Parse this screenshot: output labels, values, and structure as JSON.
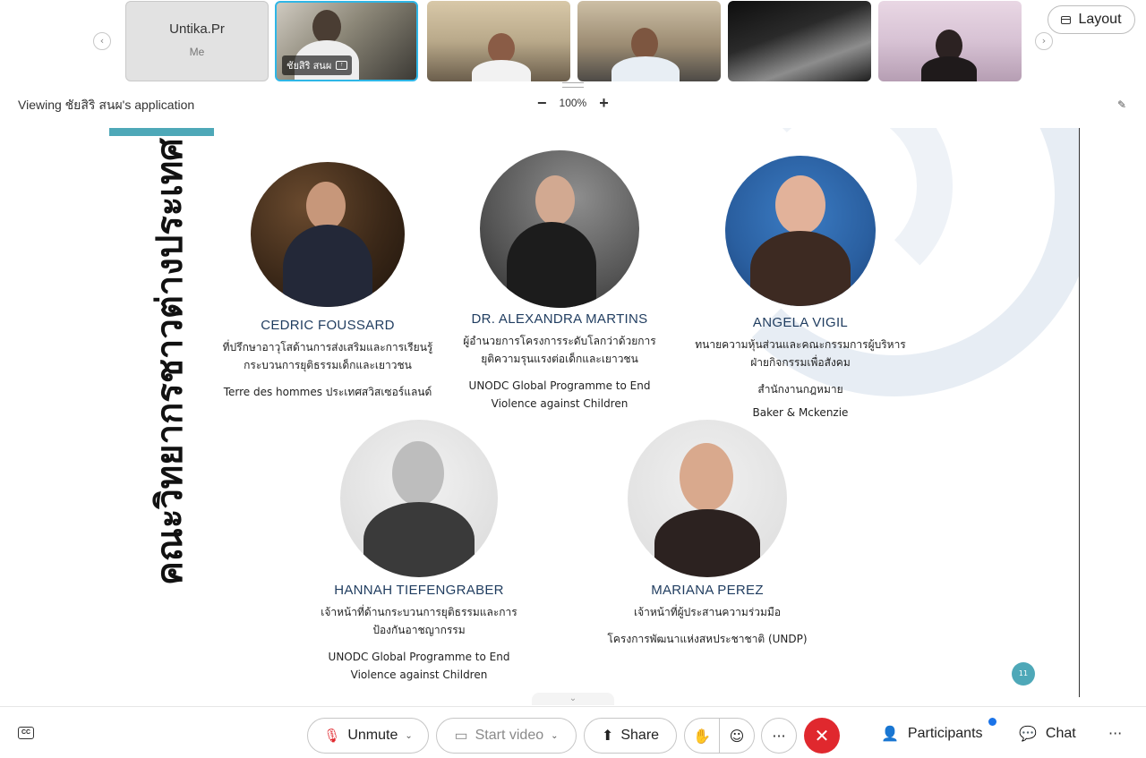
{
  "strip": {
    "self_name": "Untika.Pr",
    "self_sub": "Me",
    "active_label": "ชัยสิริ สนผ",
    "prev_icon": "chevron-left-icon",
    "next_icon": "chevron-right-icon"
  },
  "layout_button": "Layout",
  "viewing_text": "Viewing ชัยสิริ สนผ's application",
  "zoom": {
    "minus": "−",
    "level": "100%",
    "plus": "+"
  },
  "slide": {
    "title": "คณะวิทยากรชาวต่างประเทศ",
    "page_number": "11",
    "accent": "#4ea8b8",
    "speakers": [
      {
        "name": "CEDRIC FOUSSARD",
        "role": "ที่ปรึกษาอาวุโสด้านการส่งเสริมและการเรียนรู้กระบวนการยุติธรรมเด็กและเยาวชน",
        "org": "Terre des hommes ประเทศสวิสเซอร์แลนด์"
      },
      {
        "name": "DR. ALEXANDRA MARTINS",
        "role": "ผู้อำนวยการโครงการระดับโลกว่าด้วยการยุติความรุนแรงต่อเด็กและเยาวชน",
        "org": "UNODC Global Programme to End Violence against Children"
      },
      {
        "name": "ANGELA VIGIL",
        "role": "ทนายความหุ้นส่วนและคณะกรรมการผู้บริหารฝ่ายกิจกรรมเพื่อสังคม",
        "org": "สำนักงานกฎหมาย",
        "org2": "Baker & Mckenzie"
      },
      {
        "name": "HANNAH TIEFENGRABER",
        "role": "เจ้าหน้าที่ด้านกระบวนการยุติธรรมและการป้องกันอาชญากรรม",
        "org": "UNODC Global Programme to End Violence against Children"
      },
      {
        "name": "MARIANA PEREZ",
        "role": "เจ้าหน้าที่ผู้ประสานความร่วมมือ",
        "org": "โครงการพัฒนาแห่งสหประชาชาติ (UNDP)"
      }
    ]
  },
  "controls": {
    "cc": "CC",
    "unmute": "Unmute",
    "start_video": "Start video",
    "share": "Share",
    "participants": "Participants",
    "chat": "Chat",
    "more": "···",
    "end_color": "#e0282e"
  }
}
